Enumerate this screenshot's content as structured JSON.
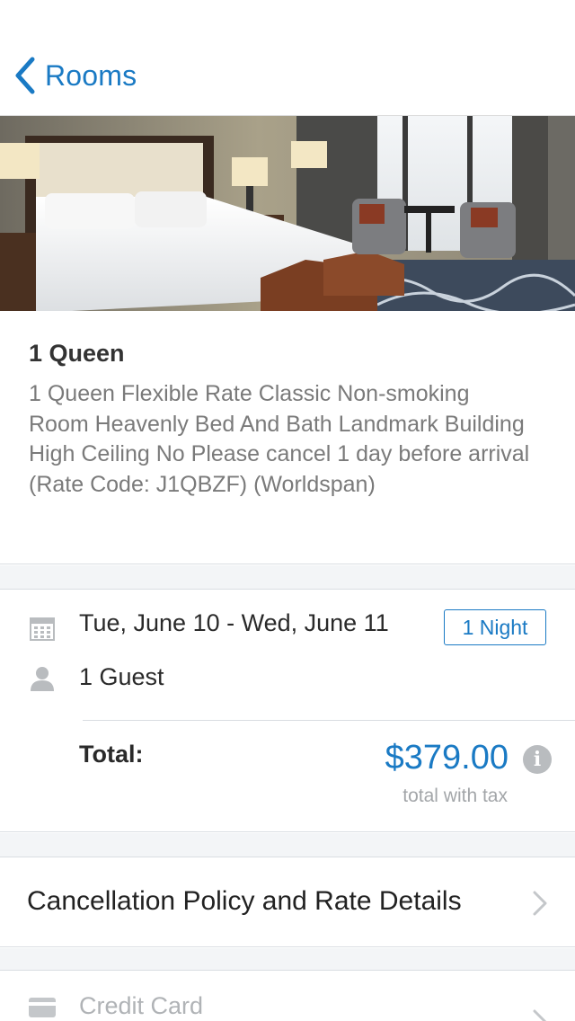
{
  "nav": {
    "back_label": "Rooms"
  },
  "hero": {
    "image_alt": "Hotel room with bed, lamps and armchairs by window"
  },
  "room": {
    "title": "1 Queen",
    "description": "1 Queen Flexible Rate Classic Non-smoking Room Heavenly Bed And Bath Landmark Building High Ceiling No Please cancel 1 day before arrival (Rate Code: J1QBZF) (Worldspan)"
  },
  "booking": {
    "dates": "Tue, June 10 - Wed, June 11",
    "nights": "1 Night",
    "guests": "1 Guest",
    "total_label": "Total:",
    "total_price": "$379.00",
    "tax_note": "total with tax",
    "info_icon_glyph": "i"
  },
  "cancellation": {
    "label": "Cancellation Policy and Rate Details"
  },
  "payment": {
    "label": "Credit Card"
  },
  "icons": {
    "back": "chevron-left-icon",
    "calendar": "calendar-icon",
    "guest": "person-icon",
    "info": "info-icon",
    "chevron": "chevron-right-icon",
    "card": "credit-card-icon"
  },
  "colors": {
    "accent": "#1a7ac4",
    "muted_text": "#7a7a7a",
    "separator_bg": "#f3f5f7"
  }
}
